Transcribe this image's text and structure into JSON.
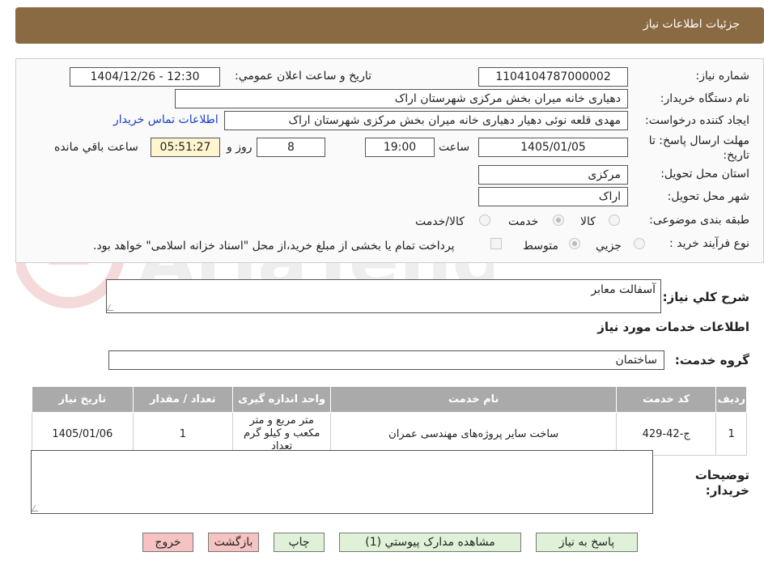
{
  "header": {
    "title": "جزئیات اطلاعات نیاز"
  },
  "form": {
    "need_number_label": "شماره نیاز:",
    "need_number": "1104104787000002",
    "announce_label": "تاریخ و ساعت اعلان عمومي:",
    "announce_value": "1404/12/26 - 12:30",
    "buyer_org_label": "نام دستگاه خریدار:",
    "buyer_org": "دهیاری خانه میران بخش مرکزی  شهرستان اراک",
    "creator_label": "ایجاد کننده درخواست:",
    "creator": "مهدی قلعه نوئی دهیار دهیاری خانه میران بخش مرکزی  شهرستان اراک",
    "contact_link": "اطلاعات تماس خریدار",
    "deadline_label": "مهلت ارسال پاسخ: تا تاریخ:",
    "deadline_date": "1405/01/05",
    "time_label": "ساعت",
    "deadline_time": "19:00",
    "days": "8",
    "days_label": "روز و",
    "remaining_time": "05:51:27",
    "remaining_label": "ساعت باقي مانده",
    "province_label": "استان محل تحویل:",
    "province": "مرکزی",
    "city_label": "شهر محل تحویل:",
    "city": "اراک",
    "category_label": "طبقه بندی موضوعی:",
    "category_options": [
      "کالا",
      "خدمت",
      "کالا/خدمت"
    ],
    "process_label": "نوع فرآیند خرید :",
    "process_options": [
      "جزيي",
      "متوسط"
    ],
    "payment_note": "پرداخت تمام یا بخشی از مبلغ خرید،از محل \"اسناد خزانه اسلامی\" خواهد بود."
  },
  "description": {
    "label": "شرح كلي نياز:",
    "value": "آسفالت معابر"
  },
  "services": {
    "section_title": "اطلاعات خدمات مورد نياز",
    "group_label": "گروه خدمت:",
    "group_value": "ساختمان",
    "columns": [
      "رديف",
      "کد خدمت",
      "نام خدمت",
      "واحد اندازه گیری",
      "تعداد / مقدار",
      "تاریخ نیاز"
    ],
    "rows": [
      [
        "1",
        "ج-42-429",
        "ساخت سایر پروژه‌های مهندسی عمران",
        "متر مربع و متر مکعب و کیلو گرم تعداد",
        "1",
        "1405/01/06"
      ]
    ]
  },
  "buyer_notes": {
    "label": "توضیحات خریدار:",
    "value": ""
  },
  "buttons": {
    "reply": "پاسخ به نياز",
    "attachments": "مشاهده مدارک پيوستي (1)",
    "print": "چاپ",
    "back": "بازگشت",
    "exit": "خروج"
  },
  "colors": {
    "header": "#8a6a42",
    "accent_link": "#1a3fc4",
    "button_green": "#dff2d8",
    "button_red": "#f6c2c2"
  }
}
